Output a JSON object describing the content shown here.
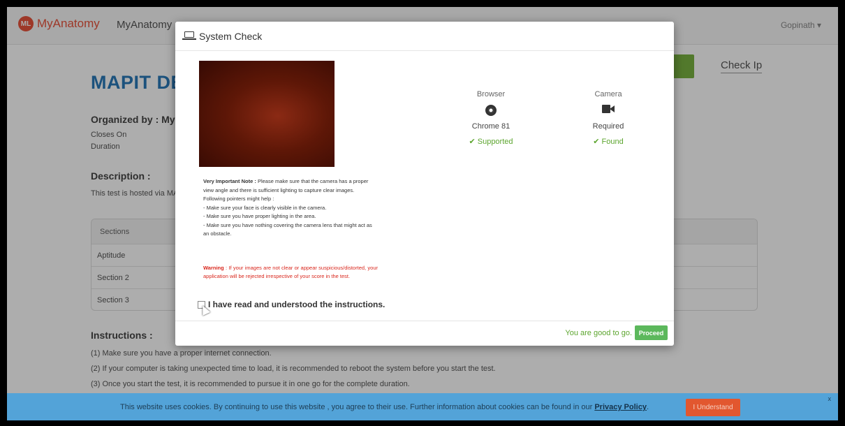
{
  "navbar": {
    "logo_badge": "ML",
    "logo_text": "MyAnatomy",
    "nav_link": "MyAnatomy",
    "user": "Gopinath ▾"
  },
  "page": {
    "title": "MAPIT DE",
    "check_link": "Check Ip",
    "organized_by": "Organized by : MyA",
    "closes_on": "Closes On",
    "duration": "Duration",
    "description_heading": "Description :",
    "description_text": "This test is hosted via MA",
    "sections": [
      "Sections",
      "Aptitude",
      "Section 2",
      "Section 3"
    ],
    "instructions_heading": "Instructions :",
    "instructions": [
      "(1) Make sure you have a proper internet connection.",
      "(2) If your computer is taking unexpected time to load, it is recommended to reboot the system before you start the test.",
      "(3) Once you start the test, it is recommended to pursue it in one go for the complete duration."
    ]
  },
  "modal": {
    "title": "System Check",
    "note_label": "Very Important Note :",
    "note_text": "Please make sure that the camera has a proper view angle and there is sufficient lighting to capture clear images.",
    "pointers_heading": "Following pointers might help :",
    "pointers": [
      "- Make sure your face is clearly visible in the camera.",
      "- Make sure you have proper lighting in the area.",
      "- Make sure you have nothing covering the camera lens that might act as  an obstacle."
    ],
    "warning_label": "Warning",
    "warning_text": " : If your images are not clear or appear suspicious/distorted, your application will be rejected irrespective of your score in the test.",
    "agree_label": "I have read and understood the instructions.",
    "browser": {
      "heading": "Browser",
      "icon": "chrome-icon",
      "value": "Chrome 81",
      "status": "✔ Supported"
    },
    "camera": {
      "heading": "Camera",
      "icon": "video-camera-icon",
      "value": "Required",
      "status": "✔ Found"
    },
    "good_to_go": "You are good to go.",
    "proceed": "Proceed"
  },
  "cookie": {
    "text": "This website uses cookies. By continuing to use this website , you agree to their use. Further information about cookies can be found in our ",
    "link": "Privacy Policy",
    "suffix": ".",
    "button": "I Understand",
    "close": "x"
  },
  "colors": {
    "brand": "#e8533c",
    "title_blue": "#2a7ab8",
    "success_green": "#5ca52e",
    "warning_red": "#d9261c",
    "cookie_bar": "#53a3d8"
  }
}
